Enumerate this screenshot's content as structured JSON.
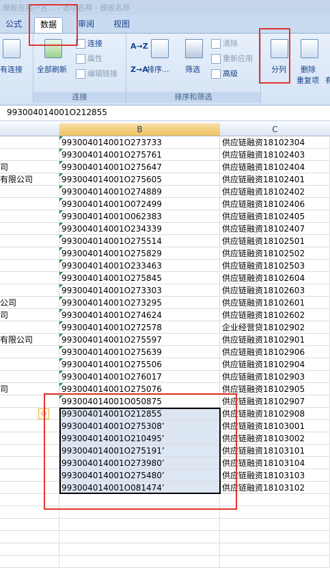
{
  "titlebar": {
    "text": "模板在用户名... - 选项名称 - 模板名称"
  },
  "tabs": [
    "公式",
    "数据",
    "审阅",
    "视图"
  ],
  "ribbon": {
    "existing_conn": "有连接",
    "refresh_all": "全部刷新",
    "connections": "连接",
    "properties": "属性",
    "edit_links": "编辑链接",
    "group_conn": "连接",
    "sort_az": "A→Z",
    "sort_za": "Z→A",
    "sort": "排序...",
    "filter": "筛选",
    "clear": "清除",
    "reapply": "重新应用",
    "advanced": "高级",
    "group_sortfilter": "排序和筛选",
    "text_to_columns": "分列",
    "remove_dup": "删除",
    "remove_dup2": "重复项",
    "extra": "有"
  },
  "formula_bar": {
    "value": "993004014001O212855"
  },
  "columns": {
    "b": "B",
    "c": "C"
  },
  "rows": [
    {
      "a": "",
      "b": "993004014001O273733",
      "c": "供应链融资18102304",
      "tri": true
    },
    {
      "a": "",
      "b": "993004014001O275761",
      "c": "供应链融资18102403",
      "tri": true
    },
    {
      "a": "司",
      "b": "993004014001O275647",
      "c": "供应链融资18102404",
      "tri": true
    },
    {
      "a": "有限公司",
      "b": "993004014001O275605",
      "c": "供应链融资18102401",
      "tri": true
    },
    {
      "a": "",
      "b": "993004014001O274889",
      "c": "供应链融资18102402",
      "tri": true
    },
    {
      "a": "",
      "b": "993004014001O072499",
      "c": "供应链融资18102406",
      "tri": true
    },
    {
      "a": "",
      "b": "993004014001O062383",
      "c": "供应链融资18102405",
      "tri": true
    },
    {
      "a": "",
      "b": "993004014001O234339",
      "c": "供应链融资18102407",
      "tri": true
    },
    {
      "a": "",
      "b": "993004014001O275514",
      "c": "供应链融资18102501",
      "tri": true
    },
    {
      "a": "",
      "b": "993004014001O275829",
      "c": "供应链融资18102502",
      "tri": true
    },
    {
      "a": "",
      "b": "993004014001O233463",
      "c": "供应链融资18102503",
      "tri": true
    },
    {
      "a": "",
      "b": "993004014001O275845",
      "c": "供应链融资18102604",
      "tri": true
    },
    {
      "a": "",
      "b": "993004014001O273303",
      "c": "供应链融资18102603",
      "tri": true
    },
    {
      "a": "公司",
      "b": "993004014001O273295",
      "c": "供应链融资18102601",
      "tri": true
    },
    {
      "a": "司",
      "b": "993004014001O274624",
      "c": "供应链融资18102602",
      "tri": true
    },
    {
      "a": "",
      "b": "993004014001O272578",
      "c": "企业经营贷18102902",
      "tri": true
    },
    {
      "a": "有限公司",
      "b": "993004014001O275597",
      "c": "供应链融资18102901",
      "tri": true
    },
    {
      "a": "",
      "b": "993004014001O275639",
      "c": "供应链融资18102906",
      "tri": true
    },
    {
      "a": "",
      "b": "993004014001O275506",
      "c": "供应链融资18102904",
      "tri": true
    },
    {
      "a": "",
      "b": "993004014001O276017",
      "c": "供应链融资18102903",
      "tri": true
    },
    {
      "a": "司",
      "b": "993004014001O275076",
      "c": "供应链融资18102905",
      "tri": true
    },
    {
      "a": "",
      "b": "993004014001O050875",
      "c": "供应链融资18102907",
      "tri": true
    },
    {
      "a": "",
      "b": "993004014001O212855",
      "c": "供应链融资18102908",
      "tri": false,
      "sel": true
    },
    {
      "a": "",
      "b": "993004014001O275308’",
      "c": "供应链融资18103001",
      "tri": false,
      "sel": true
    },
    {
      "a": "",
      "b": "993004014001O210495’",
      "c": "供应链融资18103002",
      "tri": false,
      "sel": true
    },
    {
      "a": "",
      "b": "993004014001O275191’",
      "c": "供应链融资18103101",
      "tri": false,
      "sel": true
    },
    {
      "a": "",
      "b": "993004014001O273980’",
      "c": "供应链融资18103104",
      "tri": false,
      "sel": true
    },
    {
      "a": "",
      "b": "993004014001O275480’",
      "c": "供应链融资18103103",
      "tri": false,
      "sel": true
    },
    {
      "a": "",
      "b": "993004014001O081474’",
      "c": "供应链融资18103102",
      "tri": false,
      "sel": true
    }
  ],
  "warn_icon": "◇"
}
